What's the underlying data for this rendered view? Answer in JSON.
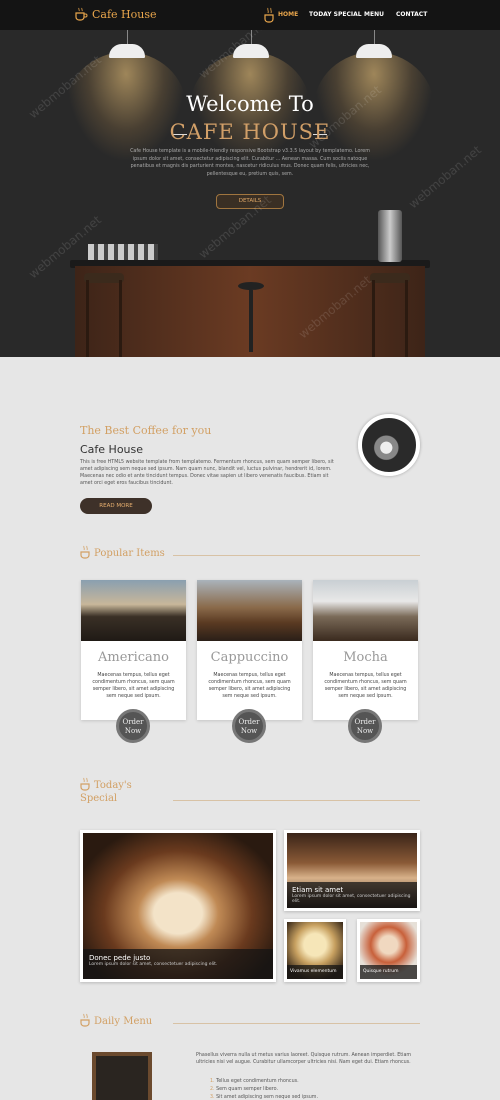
{
  "nav": {
    "brand": "Cafe House",
    "links": [
      "HOME",
      "TODAY SPECIAL",
      "MENU",
      "CONTACT"
    ]
  },
  "hero": {
    "title": "Welcome To",
    "subtitle": "CAFE HOUSE",
    "body": "Cafe House template is a mobile-friendly responsive Bootstrap v3.3.5 layout by templatemo. Lorem ipsum dolor sit amet, consectetur adipiscing elit. Curabitur ... Aenean massa. Cum sociis natoque penatibus et magnis dis parturient montes, nascetur ridiculus mus. Donec quam felis, ultricies nec, pellentesque eu, pretium quis, sem.",
    "button": "DETAILS"
  },
  "about": {
    "heading": "The Best Coffee for you",
    "title": "Cafe House",
    "body": "This is free HTML5 website template from templatemo. Fermentum rhoncus, sem quam semper libero, sit amet adipiscing sem neque sed ipsum. Nam quam nunc, blandit vel, luctus pulvinar, hendrerit id, lorem. Maecenas nec odio et ante tincidunt tempus. Donec vitae sapien ut libero venenatis faucibus. Etiam sit amet orci eget eros faucibus tincidunt.",
    "button": "READ MORE"
  },
  "popular": {
    "heading": "Popular Items",
    "items": [
      {
        "name": "Americano",
        "desc": "Maecenas tempus, tellus eget condimentum rhoncus, sem quam semper libero, sit amet adipiscing sem neque sed ipsum.",
        "button": "Order Now"
      },
      {
        "name": "Cappuccino",
        "desc": "Maecenas tempus, tellus eget condimentum rhoncus, sem quam semper libero, sit amet adipiscing sem neque sed ipsum.",
        "button": "Order Now"
      },
      {
        "name": "Mocha",
        "desc": "Maecenas tempus, tellus eget condimentum rhoncus, sem quam semper libero, sit amet adipiscing sem neque sed ipsum.",
        "button": "Order Now"
      }
    ]
  },
  "special": {
    "heading_line1": "Today's",
    "heading_line2": "Special",
    "big": {
      "title": "Donec pede justo",
      "text": "Lorem ipsum dolor sit amet, consectetuer adipiscing elit."
    },
    "top": {
      "title": "Etiam sit amet",
      "text": "Lorem ipsum dolor sit amet, consectetuer adipiscing elit."
    },
    "small1": {
      "title": "Vivamus elementum"
    },
    "small2": {
      "title": "Quisque rutrum"
    }
  },
  "menu": {
    "heading": "Daily Menu",
    "body": "Phasellus viverra nulla ut metus varius laoreet. Quisque rutrum. Aenean imperdiet. Etiam ultricies nisi vel augue. Curabitur ullamcorper ultricies nisi. Nam eget dui. Etiam rhoncus.",
    "items": [
      "Tellus eget condimentum rhoncus.",
      "Sem quam semper libero.",
      "Sit amet adipiscing sem neque sed ipsum."
    ]
  },
  "watermark": "webmoban.net"
}
